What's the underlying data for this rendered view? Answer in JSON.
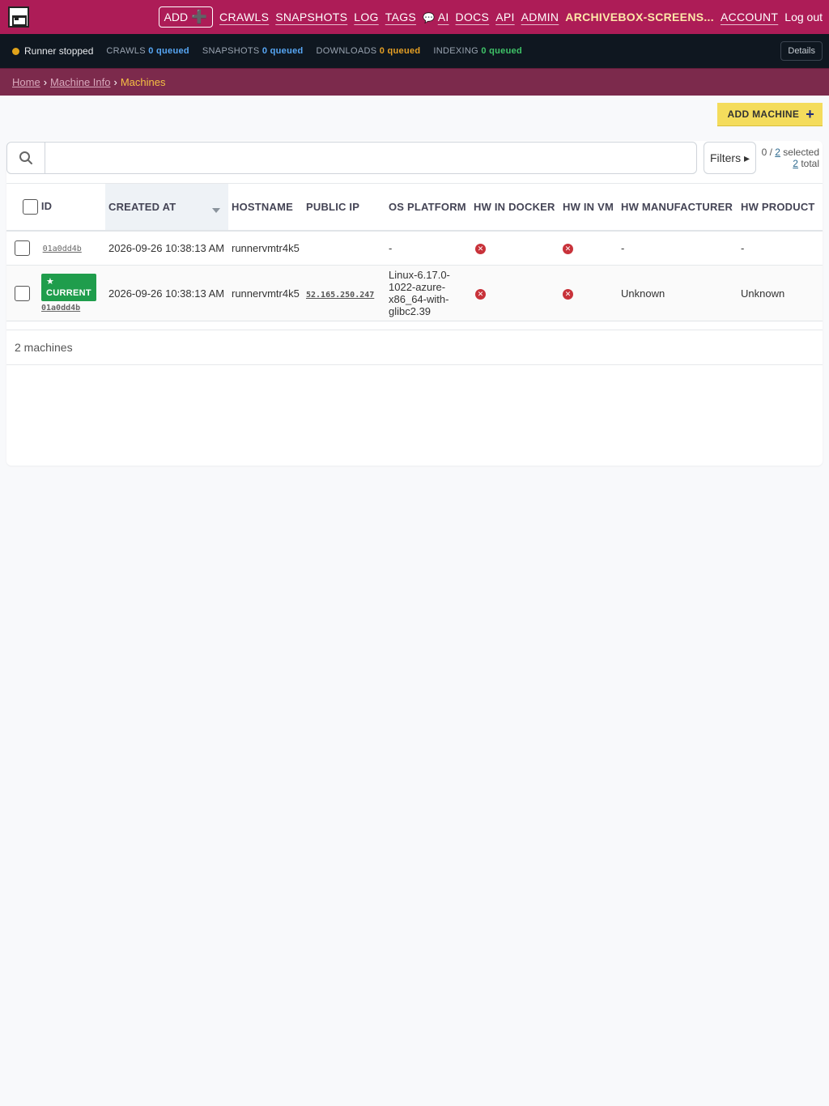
{
  "nav": {
    "add_label": "ADD",
    "links": [
      "CRAWLS",
      "SNAPSHOTS",
      "LOG",
      "TAGS",
      "AI",
      "DOCS",
      "API",
      "ADMIN"
    ],
    "ai_icon": "speech-bubble-icon",
    "user": "ARCHIVEBOX-SCREENS...",
    "account": "ACCOUNT",
    "logout": "Log out"
  },
  "status": {
    "runner": "Runner stopped",
    "crawls_label": "CRAWLS",
    "crawls_value": "0 queued",
    "snapshots_label": "SNAPSHOTS",
    "snapshots_value": "0 queued",
    "downloads_label": "DOWNLOADS",
    "downloads_value": "0 queued",
    "indexing_label": "INDEXING",
    "indexing_value": "0 queued",
    "details": "Details"
  },
  "breadcrumb": {
    "home": "Home",
    "machine_info": "Machine Info",
    "current": "Machines",
    "sep": "›"
  },
  "actions": {
    "add_machine": "ADD MACHINE"
  },
  "search": {
    "value": "",
    "placeholder": ""
  },
  "filters_label": "Filters ▸",
  "selection": {
    "selected_prefix": "0 / ",
    "selected_count": "2",
    "selected_suffix": " selected",
    "total_count": "2",
    "total_suffix": " total"
  },
  "table": {
    "columns": [
      "ID",
      "CREATED AT",
      "HOSTNAME",
      "PUBLIC IP",
      "OS PLATFORM",
      "HW IN DOCKER",
      "HW IN VM",
      "HW MANUFACTURER",
      "HW PRODUCT"
    ],
    "rows": [
      {
        "id": "01a0dd4b",
        "created_at": "2026-09-26 10:38:13 AM",
        "hostname": "runnervmtr4k5",
        "public_ip": "",
        "os_platform": "-",
        "hw_in_docker": "no",
        "hw_in_vm": "no",
        "hw_manufacturer": "-",
        "hw_product": "-"
      },
      {
        "badge": "★ CURRENT",
        "id": "01a0dd4b",
        "created_at": "2026-09-26 10:38:13 AM",
        "hostname": "runnervmtr4k5",
        "public_ip": "52.165.250.247",
        "os_platform": "Linux-6.17.0-1022-azure-x86_64-with-glibc2.39",
        "hw_in_docker": "no",
        "hw_in_vm": "no",
        "hw_manufacturer": "Unknown",
        "hw_product": "Unknown"
      }
    ]
  },
  "footer": {
    "count": "2 machines"
  },
  "colors": {
    "nav_bg": "#ad1c57",
    "status_bg": "#0f1720",
    "breadcrumb_bg": "#7c2a4c",
    "accent_yellow": "#f4dc5c",
    "badge_green": "#1f9d4c",
    "error_red": "#c8323a"
  }
}
